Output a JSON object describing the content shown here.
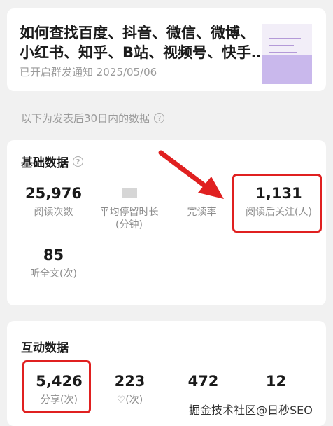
{
  "article": {
    "title_line1": "如何查找百度、抖音、微信、微博、",
    "title_line2": "小红书、知乎、B站、视频号、快手…",
    "status": "已开启群发通知 2025/05/06"
  },
  "note": "以下为发表后30日内的数据",
  "basic": {
    "title": "基础数据",
    "stats": [
      {
        "value": "25,976",
        "label": "阅读次数"
      },
      {
        "value": "",
        "label": "平均停留时长\n(分钟)"
      },
      {
        "value": "",
        "label": "完读率"
      },
      {
        "value": "1,131",
        "label": "阅读后关注(人)"
      },
      {
        "value": "85",
        "label": "听全文(次)"
      }
    ]
  },
  "interact": {
    "title": "互动数据",
    "stats": [
      {
        "value": "5,426",
        "label": "分享(次)"
      },
      {
        "value": "223",
        "label": "♡(次)"
      },
      {
        "value": "472",
        "label": ""
      },
      {
        "value": "12",
        "label": ""
      }
    ]
  },
  "watermark": "掘金技术社区@日秒SEO",
  "colors": {
    "highlight": "#e02020",
    "card": "#ffffff",
    "background": "#f1f1f1"
  }
}
